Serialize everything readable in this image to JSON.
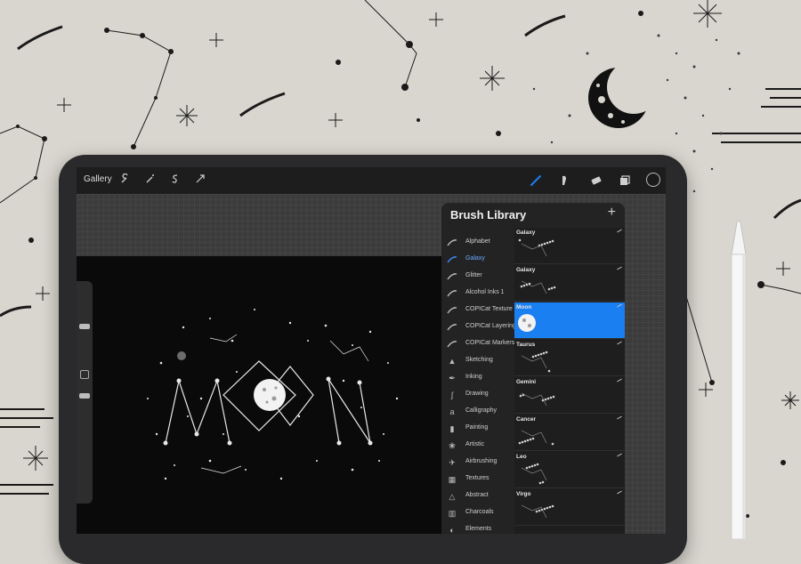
{
  "toolbar": {
    "gallery_label": "Gallery",
    "left_tools": [
      "wrench-icon",
      "magic-wand-icon",
      "selection-icon",
      "transform-arrow-icon"
    ],
    "right_tools": [
      "brush-icon",
      "smudge-icon",
      "eraser-icon",
      "layers-icon"
    ],
    "active_tool": "brush-icon",
    "color_swatch": "#1a1a1a"
  },
  "artwork": {
    "letters": [
      "M",
      "O",
      "N"
    ]
  },
  "brush_library": {
    "title": "Brush Library",
    "add_label": "+",
    "categories": [
      {
        "label": "Alphabet",
        "icon": "stroke"
      },
      {
        "label": "Galaxy",
        "icon": "stroke",
        "active": true
      },
      {
        "label": "Glitter",
        "icon": "stroke"
      },
      {
        "label": "Alcohol Inks 1",
        "icon": "stroke"
      },
      {
        "label": "COPICat Texture Tools",
        "icon": "stroke"
      },
      {
        "label": "COPICat Layering",
        "icon": "stroke"
      },
      {
        "label": "COPICat Markers",
        "icon": "stroke"
      },
      {
        "label": "Sketching",
        "icon": "▲"
      },
      {
        "label": "Inking",
        "icon": "✒"
      },
      {
        "label": "Drawing",
        "icon": "ʃ"
      },
      {
        "label": "Calligraphy",
        "icon": "a"
      },
      {
        "label": "Painting",
        "icon": "▮"
      },
      {
        "label": "Artistic",
        "icon": "❀"
      },
      {
        "label": "Airbrushing",
        "icon": "✈"
      },
      {
        "label": "Textures",
        "icon": "▦"
      },
      {
        "label": "Abstract",
        "icon": "△"
      },
      {
        "label": "Charcoals",
        "icon": "▥"
      },
      {
        "label": "Elements",
        "icon": "◐"
      }
    ],
    "brushes": [
      {
        "name": "Galaxy"
      },
      {
        "name": "Galaxy"
      },
      {
        "name": "Moon",
        "selected": true
      },
      {
        "name": "Taurus"
      },
      {
        "name": "Gemini"
      },
      {
        "name": "Cancer"
      },
      {
        "name": "Leo"
      },
      {
        "name": "Virgo"
      }
    ]
  },
  "colors": {
    "accent": "#1a7ff0",
    "canvas": "#0a0a0a",
    "background": "#d9d6cf"
  }
}
